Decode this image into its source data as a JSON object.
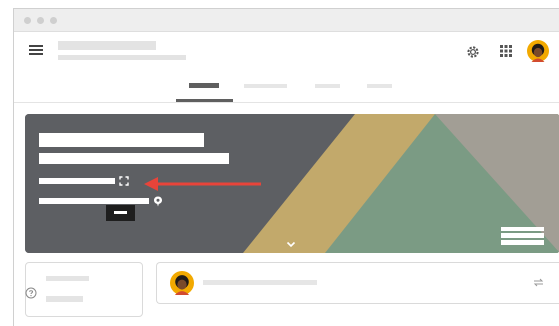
{
  "window": {
    "traffic_lights": [
      "close-dot",
      "minimize-dot",
      "zoom-dot"
    ]
  },
  "header": {
    "menu_icon": "hamburger-menu-icon",
    "settings_icon": "gear-icon",
    "apps_icon": "apps-grid-icon",
    "avatar_icon": "user-avatar-icon"
  },
  "tabs": {
    "count": 4,
    "active_index": 0
  },
  "banner": {
    "fullscreen_icon": "fullscreen-icon",
    "expand_icon": "chevron-down-icon",
    "meeting_link_icon": "meet-icon",
    "annotation_arrow_color": "#e8443a",
    "background_color": "#5d5f63",
    "accent_colors": [
      "#c2a96b",
      "#7b9b84",
      "#a29e95"
    ]
  },
  "upcoming_card": {
    "help_icon": "help-circle-icon"
  },
  "post_card": {
    "avatar_icon": "user-avatar-icon",
    "repost_icon": "repost-icon"
  }
}
